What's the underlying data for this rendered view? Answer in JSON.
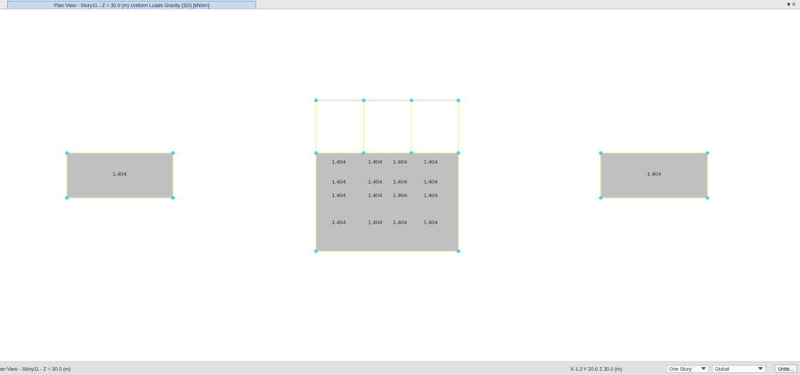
{
  "window": {
    "title": "Plan View - Story11 - Z = 30.0 (m) Uniform Loads Gravity (SD) [kN/m²]",
    "controls": [
      "▾",
      "×"
    ]
  },
  "canvas": {
    "left_slab": {
      "label": "1.404"
    },
    "center_slab": {
      "label_rows": [
        [
          "1.404",
          "1.404",
          "1.404",
          "1.404"
        ],
        [
          "1.404",
          "1.404",
          "1.404",
          "1.404"
        ],
        [
          "1.404",
          "1.404",
          "1.404",
          "1.404"
        ],
        [
          "1.404",
          "1.404",
          "1.404",
          "1.404"
        ]
      ]
    },
    "right_slab": {
      "label": "1.404"
    }
  },
  "status_bar": {
    "view": "an View - Story11 - Z = 30.0 (m)",
    "coordinates": "X-1.2  Y 20.6  Z 30.0 (m)",
    "story_select": "One Story",
    "coord_system": "Global",
    "units_button": "Units..."
  }
}
